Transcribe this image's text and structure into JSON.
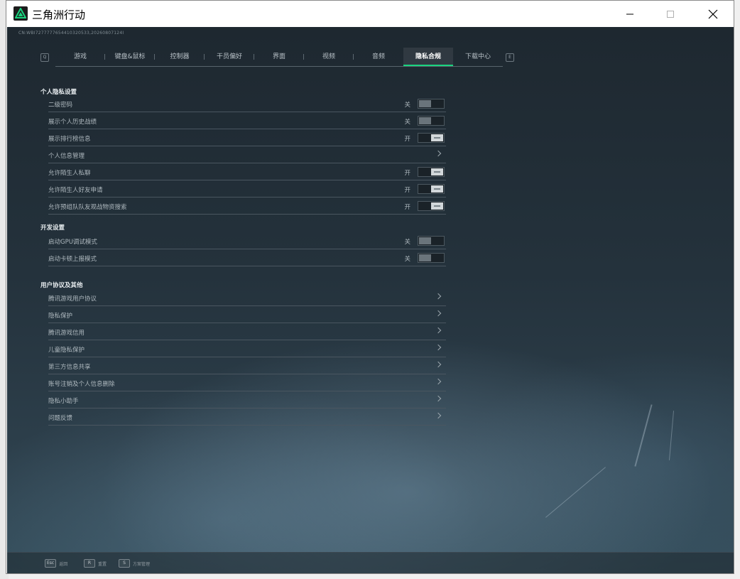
{
  "window": {
    "title": "三角洲行动"
  },
  "build_info": "CN:WBI7277777654410320533,20260807124I",
  "tabs": {
    "prev_key": "Q",
    "next_key": "E",
    "items": [
      {
        "label": "游戏",
        "width": 70
      },
      {
        "label": "键盘&鼠标",
        "width": 70
      },
      {
        "label": "控制器",
        "width": 70
      },
      {
        "label": "干员偏好",
        "width": 70
      },
      {
        "label": "界面",
        "width": 70
      },
      {
        "label": "视频",
        "width": 70
      },
      {
        "label": "音频",
        "width": 70
      },
      {
        "label": "隐私合规",
        "width": 70
      },
      {
        "label": "下载中心",
        "width": 70
      }
    ],
    "active_index": 7
  },
  "sections": {
    "privacy": {
      "title": "个人隐私设置",
      "rows": [
        {
          "label": "二级密码",
          "state": "关"
        },
        {
          "label": "展示个人历史战绩",
          "state": "关"
        },
        {
          "label": "展示排行榜信息",
          "state": "开"
        },
        {
          "label": "个人信息管理"
        },
        {
          "label": "允许陌生人私聊",
          "state": "开"
        },
        {
          "label": "允许陌生人好友申请",
          "state": "开"
        },
        {
          "label": "允许预组队队友观战物资搜索",
          "state": "开"
        }
      ]
    },
    "dev": {
      "title": "开发设置",
      "rows": [
        {
          "label": "启动GPU调试模式",
          "state": "关"
        },
        {
          "label": "启动卡顿上报模式",
          "state": "关"
        }
      ]
    },
    "agreements": {
      "title": "用户协议及其他",
      "rows": [
        {
          "label": "腾讯游戏用户协议"
        },
        {
          "label": "隐私保护"
        },
        {
          "label": "腾讯游戏信用"
        },
        {
          "label": "儿童隐私保护"
        },
        {
          "label": "第三方信息共享"
        },
        {
          "label": "账号注销及个人信息删除"
        },
        {
          "label": "隐私小助手"
        },
        {
          "label": "问题反馈"
        }
      ]
    }
  },
  "bottom_hints": [
    {
      "key": "Esc",
      "label": "返回"
    },
    {
      "key": "R",
      "label": "重置"
    },
    {
      "key": "S",
      "label": "方案管理"
    }
  ]
}
